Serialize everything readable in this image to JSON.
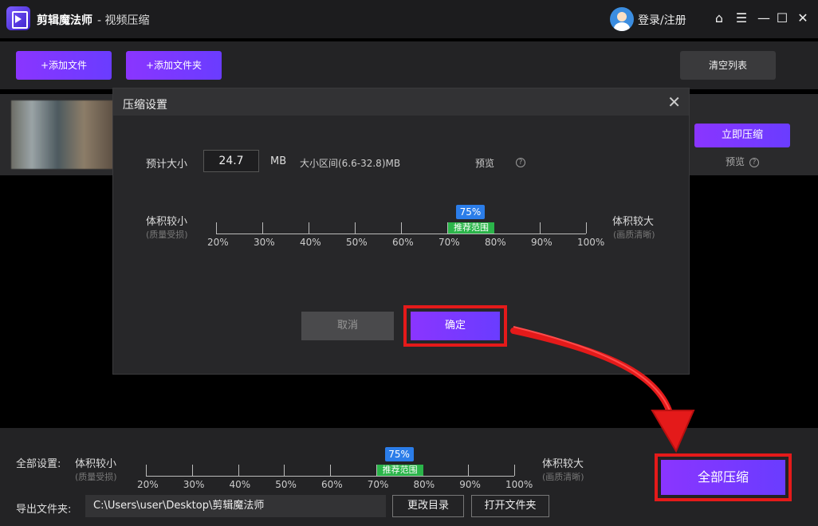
{
  "app": {
    "name": "剪辑魔法师",
    "subtitle": "- 视频压缩",
    "login": "登录/注册"
  },
  "window_controls": [
    "home-icon",
    "menu-icon",
    "minimize-icon",
    "maximize-icon",
    "close-icon"
  ],
  "toolbar": {
    "add_file": "+添加文件",
    "add_folder": "+添加文件夹",
    "clear_list": "清空列表"
  },
  "file_row": {
    "compress_now": "立即压缩",
    "preview": "预览"
  },
  "modal": {
    "title": "压缩设置",
    "estimated_size_label": "预计大小",
    "estimated_size_value": "24.7",
    "unit": "MB",
    "range_text": "大小区间(6.6-32.8)MB",
    "preview": "预览",
    "slider": {
      "left_label": "体积较小",
      "left_sub": "(质量受损)",
      "right_label": "体积较大",
      "right_sub": "(画质清晰)",
      "value_label": "75%",
      "value": 75,
      "recommend": "推荐范围",
      "ticks": [
        "20%",
        "30%",
        "40%",
        "50%",
        "60%",
        "70%",
        "80%",
        "90%",
        "100%"
      ]
    },
    "cancel": "取消",
    "confirm": "确定"
  },
  "bottom": {
    "all_settings": "全部设置:",
    "slider": {
      "left_label": "体积较小",
      "left_sub": "(质量受损)",
      "right_label": "体积较大",
      "right_sub": "(画质清晰)",
      "value_label": "75%",
      "value": 75,
      "recommend": "推荐范围",
      "ticks": [
        "20%",
        "30%",
        "40%",
        "50%",
        "60%",
        "70%",
        "80%",
        "90%",
        "100%"
      ]
    },
    "export_label": "导出文件夹:",
    "export_path": "C:\\Users\\user\\Desktop\\剪辑魔法师",
    "change_dir": "更改目录",
    "open_folder": "打开文件夹",
    "compress_all": "全部压缩"
  },
  "colors": {
    "accent": "#7b3cff",
    "highlight": "#e41a1a",
    "recommend": "#2bb54a",
    "bubble": "#2b7de9"
  }
}
